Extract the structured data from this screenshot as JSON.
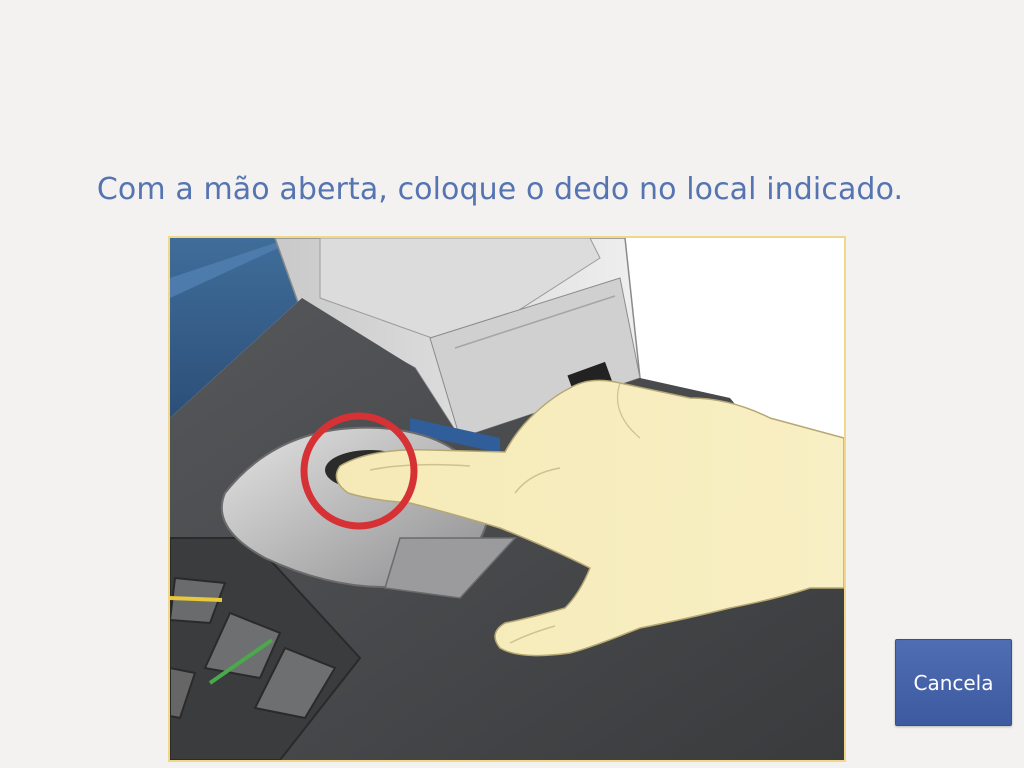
{
  "prompt": {
    "text": "Com a mão aberta, coloque o dedo no local indicado."
  },
  "illustration": {
    "icon": "finger-on-biometric-reader-illustration",
    "highlight_color": "#d63134",
    "frame_color": "#f0d78a"
  },
  "actions": {
    "cancel_label": "Cancela"
  },
  "colors": {
    "text_primary": "#5574b1",
    "button": "#4363a8",
    "background": "#f3f2f1"
  }
}
